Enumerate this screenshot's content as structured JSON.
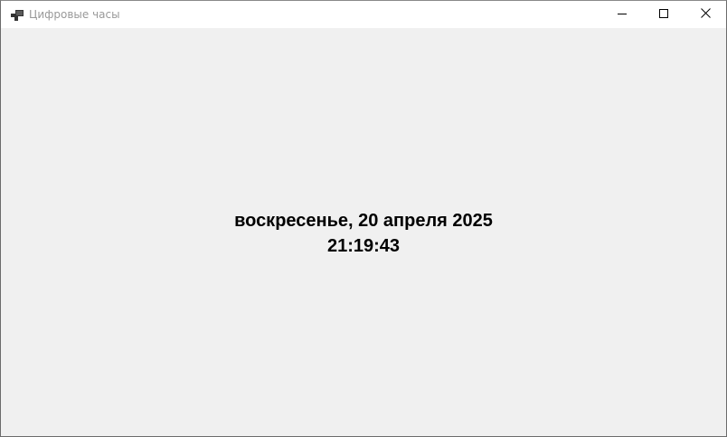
{
  "window": {
    "title": "Цифровые часы",
    "app_icon": "windows-form-icon",
    "controls": {
      "minimize_icon": "minimize-icon",
      "maximize_icon": "maximize-icon",
      "close_icon": "close-icon"
    }
  },
  "clock": {
    "date": "воскресенье, 20 апреля 2025",
    "time": "21:19:43"
  },
  "colors": {
    "client_background": "#f0f0f0",
    "titlebar_background": "#ffffff",
    "title_text": "#999999",
    "clock_text": "#000000"
  }
}
